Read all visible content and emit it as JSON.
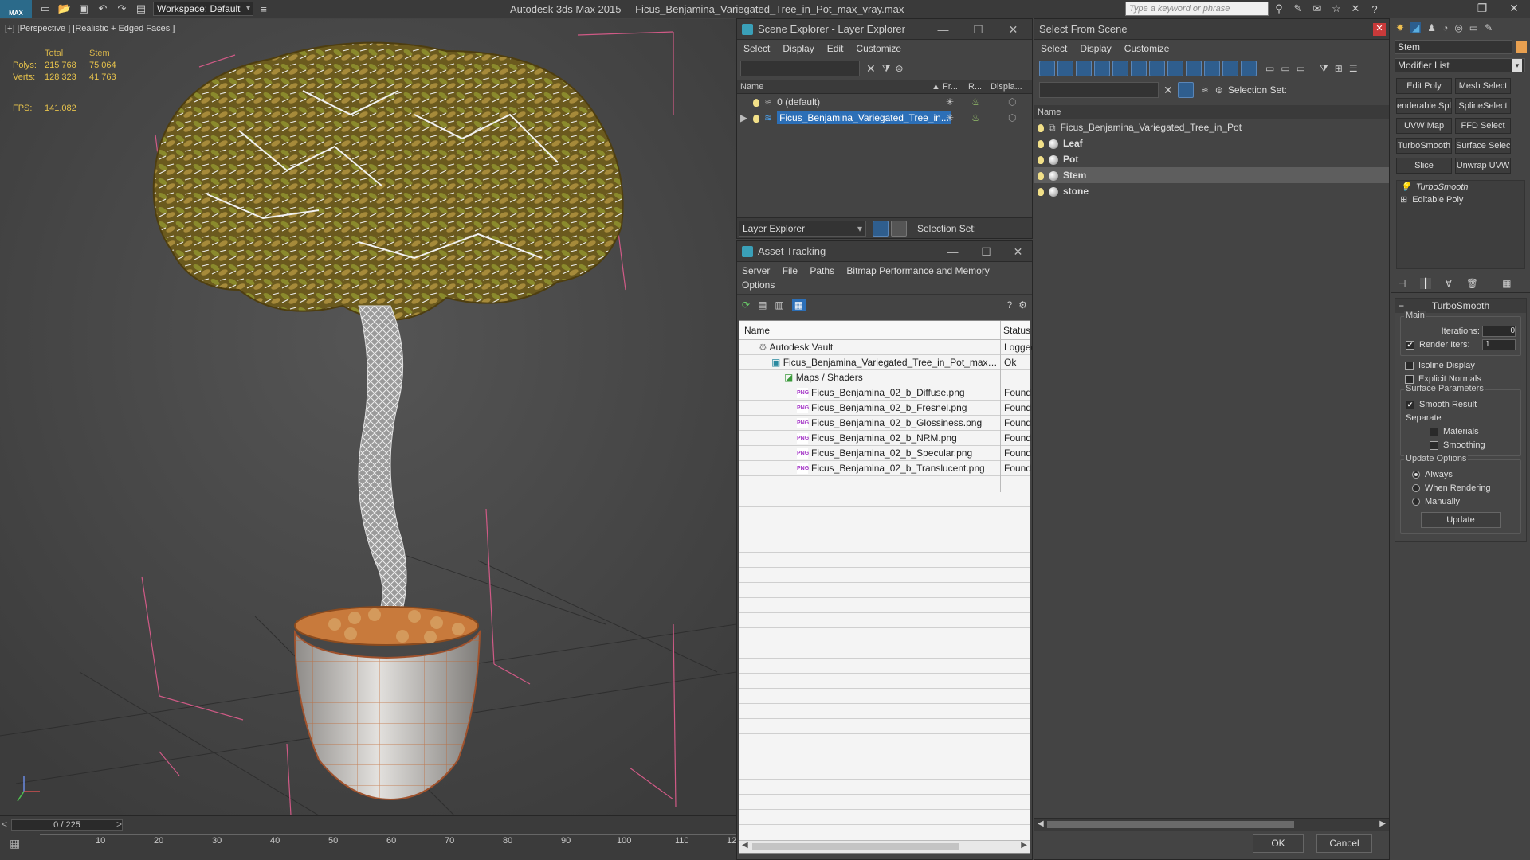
{
  "app": {
    "title": "Autodesk 3ds Max  2015",
    "filename": "Ficus_Benjamina_Variegated_Tree_in_Pot_max_vray.max",
    "logo_text": "MAX",
    "workspace": "Workspace: Default",
    "search_placeholder": "Type a keyword or phrase"
  },
  "viewport": {
    "label": "[+] [Perspective ] [Realistic + Edged Faces ]",
    "stats": {
      "col_total": "Total",
      "col_object": "Stem",
      "polys_label": "Polys:",
      "polys_total": "215 768",
      "polys_obj": "75 064",
      "verts_label": "Verts:",
      "verts_total": "128 323",
      "verts_obj": "41 763",
      "fps_label": "FPS:",
      "fps_value": "141.082"
    }
  },
  "timeline": {
    "frame": "0 / 225",
    "ticks": [
      "10",
      "20",
      "30",
      "40",
      "50",
      "60",
      "70",
      "80",
      "90",
      "100",
      "110",
      "12"
    ]
  },
  "scene_explorer": {
    "title": "Scene Explorer - Layer Explorer",
    "menu": [
      "Select",
      "Display",
      "Edit",
      "Customize"
    ],
    "columns": {
      "name": "Name",
      "freeze": "Fr...",
      "render": "R...",
      "display": "Displa..."
    },
    "rows": [
      "0 (default)",
      "Ficus_Benjamina_Variegated_Tree_in..."
    ],
    "footer_dropdown": "Layer Explorer",
    "selection_set": "Selection Set:"
  },
  "asset_tracking": {
    "title": "Asset Tracking",
    "menu1": [
      "Server",
      "File",
      "Paths",
      "Bitmap Performance and Memory"
    ],
    "menu2": [
      "Options"
    ],
    "col_name": "Name",
    "col_status": "Status",
    "vault": {
      "name": "Autodesk Vault",
      "status": "Logged"
    },
    "file": {
      "name": "Ficus_Benjamina_Variegated_Tree_in_Pot_max_vr...",
      "status": "Ok"
    },
    "maps": {
      "name": "Maps / Shaders"
    },
    "png_label": "PNG",
    "items": [
      {
        "name": "Ficus_Benjamina_02_b_Diffuse.png",
        "status": "Found"
      },
      {
        "name": "Ficus_Benjamina_02_b_Fresnel.png",
        "status": "Found"
      },
      {
        "name": "Ficus_Benjamina_02_b_Glossiness.png",
        "status": "Found"
      },
      {
        "name": "Ficus_Benjamina_02_b_NRM.png",
        "status": "Found"
      },
      {
        "name": "Ficus_Benjamina_02_b_Specular.png",
        "status": "Found"
      },
      {
        "name": "Ficus_Benjamina_02_b_Translucent.png",
        "status": "Found"
      }
    ]
  },
  "select_from_scene": {
    "title": "Select From Scene",
    "menu": [
      "Select",
      "Display",
      "Customize"
    ],
    "selection_set": "Selection Set:",
    "col_name": "Name",
    "rows": [
      {
        "name": "Ficus_Benjamina_Variegated_Tree_in_Pot",
        "group": true,
        "selected": false
      },
      {
        "name": "Leaf",
        "group": false,
        "selected": false
      },
      {
        "name": "Pot",
        "group": false,
        "selected": false
      },
      {
        "name": "Stem",
        "group": false,
        "selected": true
      },
      {
        "name": "stone",
        "group": false,
        "selected": false
      }
    ],
    "ok": "OK",
    "cancel": "Cancel"
  },
  "command_panel": {
    "object_name": "Stem",
    "object_color": "#e8a050",
    "modifier_list": "Modifier List",
    "buttons": [
      "Edit Poly",
      "Mesh Select",
      "enderable Spli",
      "SplineSelect",
      "UVW Map",
      "FFD Select",
      "TurboSmooth",
      "Surface Select",
      "Slice",
      "Unwrap UVW"
    ],
    "stack": [
      "TurboSmooth",
      "Editable Poly"
    ],
    "rollout_title": "TurboSmooth",
    "main_label": "Main",
    "iterations_label": "Iterations:",
    "iterations_value": "0",
    "render_iters_label": "Render Iters:",
    "render_iters_value": "1",
    "isoline": "Isoline Display",
    "explicit_normals": "Explicit Normals",
    "surface_params": "Surface Parameters",
    "smooth_result": "Smooth Result",
    "separate": "Separate",
    "materials": "Materials",
    "smoothing_groups": "Smoothing Groups",
    "update_options": "Update Options",
    "always": "Always",
    "when_rendering": "When Rendering",
    "manually": "Manually",
    "update_btn": "Update"
  }
}
